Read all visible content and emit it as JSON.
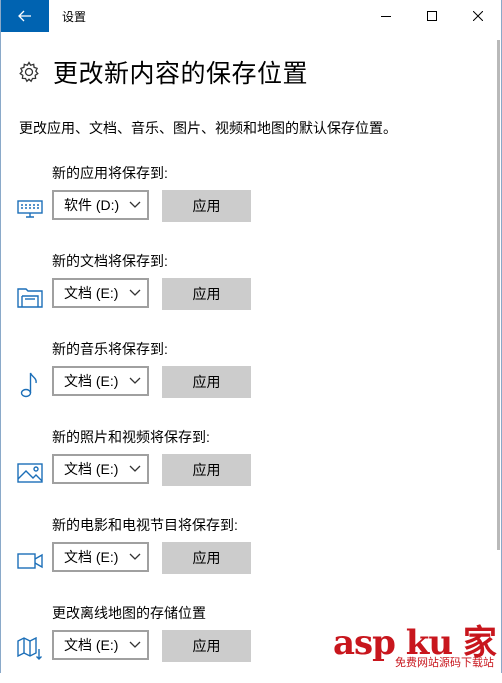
{
  "window": {
    "title": "设置"
  },
  "page": {
    "title": "更改新内容的保存位置",
    "description": "更改应用、文档、音乐、图片、视频和地图的默认保存位置。"
  },
  "sections": [
    {
      "label": "新的应用将保存到:",
      "drive": "软件 (D:)",
      "apply": "应用",
      "icon": "monitor-icon"
    },
    {
      "label": "新的文档将保存到:",
      "drive": "文档 (E:)",
      "apply": "应用",
      "icon": "documents-folder-icon"
    },
    {
      "label": "新的音乐将保存到:",
      "drive": "文档 (E:)",
      "apply": "应用",
      "icon": "music-note-icon"
    },
    {
      "label": "新的照片和视频将保存到:",
      "drive": "文档 (E:)",
      "apply": "应用",
      "icon": "picture-icon"
    },
    {
      "label": "新的电影和电视节目将保存到:",
      "drive": "文档 (E:)",
      "apply": "应用",
      "icon": "video-camera-icon"
    },
    {
      "label": "更改离线地图的存储位置",
      "drive": "文档 (E:)",
      "apply": "应用",
      "icon": "map-icon"
    }
  ],
  "watermark": {
    "main": "asp ku 家",
    "sub": "免费网站源码下载站"
  },
  "colors": {
    "accent": "#0063b1",
    "icon_blue": "#1c6fb8",
    "button_gray": "#cccccc",
    "watermark_red": "#c8161d"
  }
}
